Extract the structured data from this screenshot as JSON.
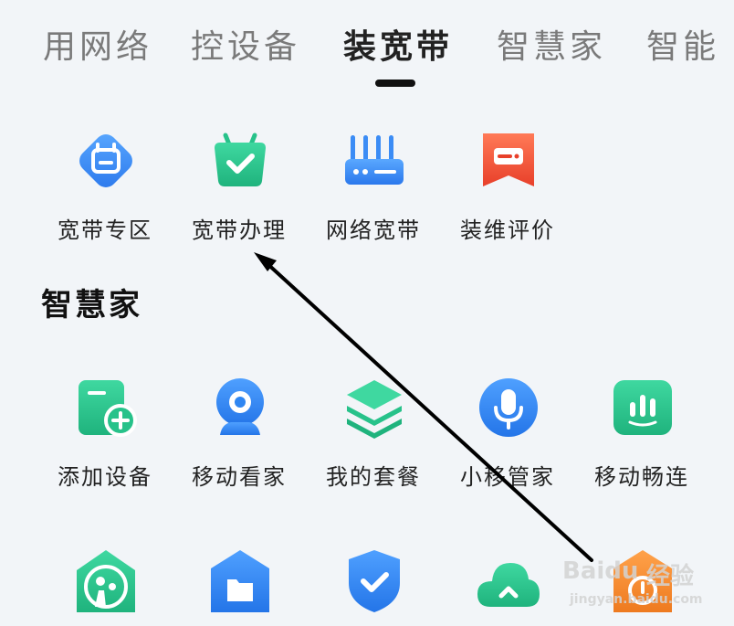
{
  "tabs": [
    {
      "label": "用网络"
    },
    {
      "label": "控设备"
    },
    {
      "label": "装宽带",
      "active": true
    },
    {
      "label": "智慧家"
    },
    {
      "label": "智能"
    }
  ],
  "broadband": {
    "items": [
      {
        "label": "宽带专区",
        "icon": "broadband-zone-icon",
        "color": "#3b8cf5"
      },
      {
        "label": "宽带办理",
        "icon": "broadband-apply-icon",
        "color": "#27c28a"
      },
      {
        "label": "网络宽带",
        "icon": "router-icon",
        "color": "#3b8cf5"
      },
      {
        "label": "装维评价",
        "icon": "review-icon",
        "color": "#f05a3c"
      }
    ]
  },
  "smart_home": {
    "title": "智慧家",
    "items": [
      {
        "label": "添加设备",
        "icon": "add-device-icon",
        "color": "#27c28a"
      },
      {
        "label": "移动看家",
        "icon": "camera-icon",
        "color": "#2f86f2"
      },
      {
        "label": "我的套餐",
        "icon": "package-layers-icon",
        "color": "#27c28a"
      },
      {
        "label": "小移管家",
        "icon": "microphone-icon",
        "color": "#2f86f2"
      },
      {
        "label": "移动畅连",
        "icon": "chat-icon",
        "color": "#27c28a"
      }
    ]
  },
  "bottom_row": {
    "items": [
      {
        "icon": "family-home-icon",
        "color": "#27c28a"
      },
      {
        "icon": "folder-icon",
        "color": "#2f86f2"
      },
      {
        "icon": "security-shield-icon",
        "color": "#2f86f2"
      },
      {
        "icon": "cloud-icon",
        "color": "#27c28a"
      },
      {
        "icon": "orange-app-icon",
        "color": "#f08a2a"
      }
    ]
  },
  "watermark": {
    "brand": "Baidu",
    "suffix": "经验",
    "url": "jingyan.baidu.com"
  }
}
